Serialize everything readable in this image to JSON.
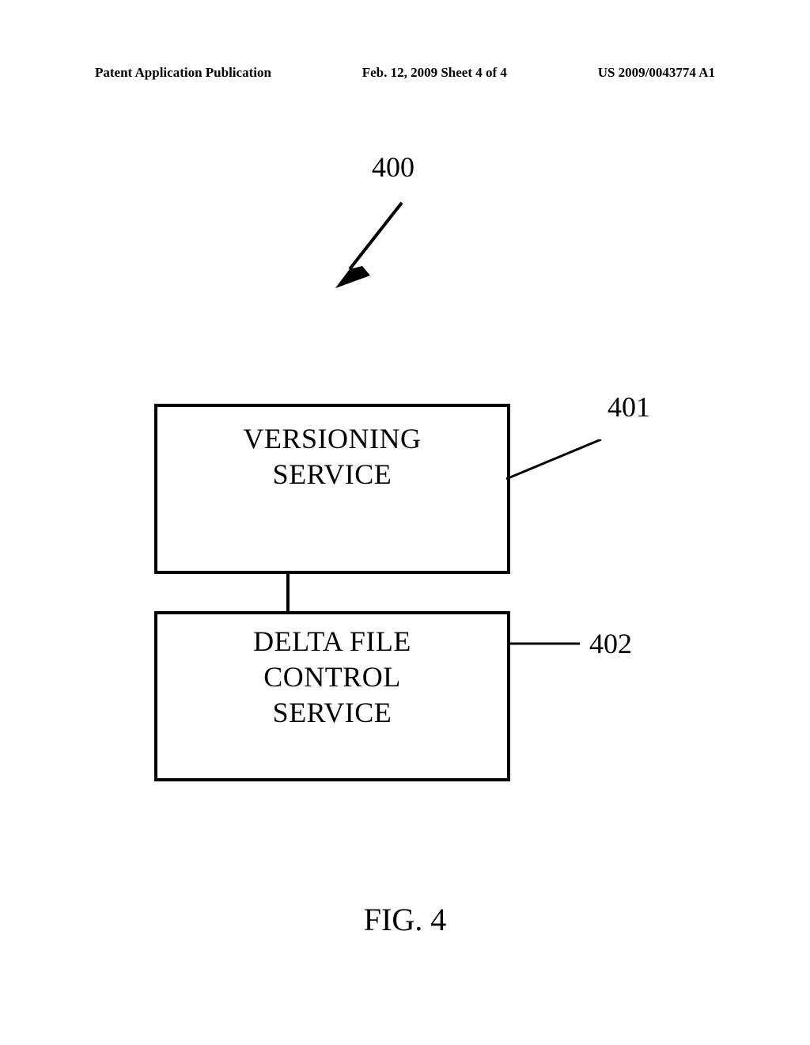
{
  "header": {
    "left": "Patent Application Publication",
    "center": "Feb. 12, 2009  Sheet 4 of 4",
    "right": "US 2009/0043774 A1"
  },
  "refs": {
    "r400": "400",
    "r401": "401",
    "r402": "402"
  },
  "boxes": {
    "box1_line1": "VERSIONING",
    "box1_line2": "SERVICE",
    "box2_line1": "DELTA FILE",
    "box2_line2": "CONTROL",
    "box2_line3": "SERVICE"
  },
  "figure_label": "FIG. 4"
}
